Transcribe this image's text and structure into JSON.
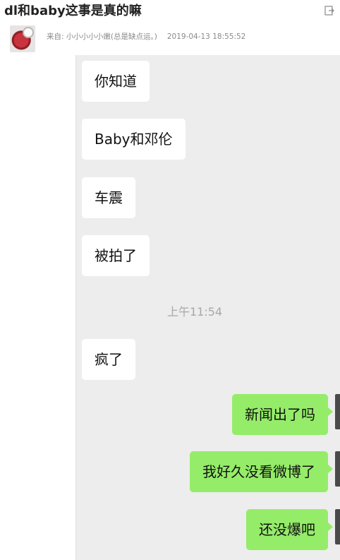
{
  "post": {
    "title": "dl和baby这事是真的嘛",
    "meta": {
      "from_label": "来自: ",
      "author": "小小小小小嫩(总是缺点运。)",
      "datetime": "2019-04-13 18:55:52"
    }
  },
  "chat": {
    "messages": [
      {
        "side": "in",
        "text": "你知道"
      },
      {
        "side": "in",
        "text": "Baby和邓伦"
      },
      {
        "side": "in",
        "text": "车震"
      },
      {
        "side": "in",
        "text": "被拍了"
      },
      {
        "side": "in",
        "text": "疯了"
      },
      {
        "side": "out",
        "text": "新闻出了吗"
      },
      {
        "side": "out",
        "text": "我好久没看微博了"
      },
      {
        "side": "out",
        "text": "还没爆吧"
      }
    ],
    "timestamp": "上午11:54",
    "colors": {
      "background": "#ededed",
      "incoming_bubble": "#ffffff",
      "outgoing_bubble": "#95ec69"
    }
  },
  "icons": {
    "share": "share-icon"
  }
}
